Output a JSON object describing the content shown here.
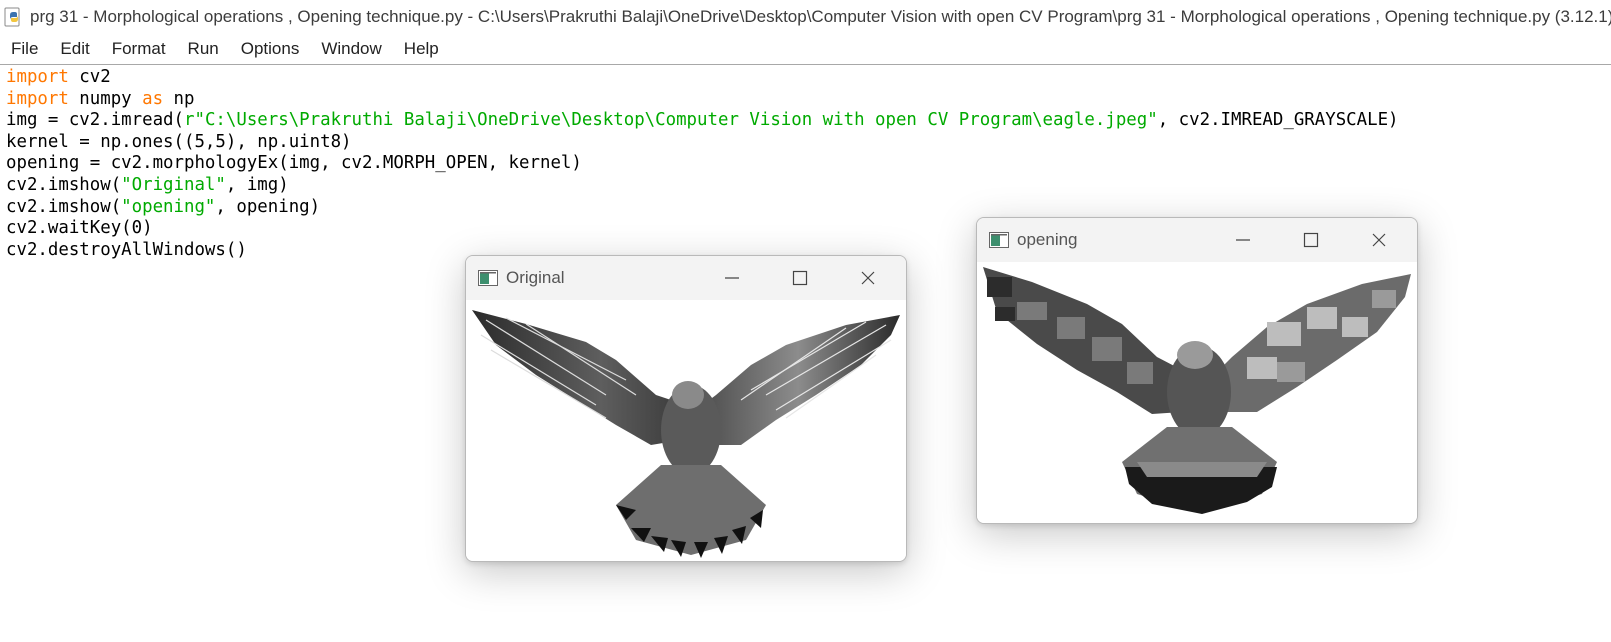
{
  "window": {
    "title": "prg 31 -  Morphological operations ,  Opening technique.py - C:\\Users\\Prakruthi Balaji\\OneDrive\\Desktop\\Computer Vision with open CV Program\\prg 31 -  Morphological operations ,  Opening technique.py (3.12.1)",
    "app_icon": "python-idle-icon"
  },
  "menu": [
    "File",
    "Edit",
    "Format",
    "Run",
    "Options",
    "Window",
    "Help"
  ],
  "code": {
    "l1": {
      "kw": "import",
      "rest": " cv2"
    },
    "l2": {
      "kw1": "import",
      "mid": " numpy ",
      "kw2": "as",
      "rest": " np"
    },
    "l3": {
      "pre": "img = cv2.imread(",
      "str": "r\"C:\\Users\\Prakruthi Balaji\\OneDrive\\Desktop\\Computer Vision with open CV Program\\eagle.jpeg\"",
      "post": ", cv2.IMREAD_GRAYSCALE)"
    },
    "l4": "kernel = np.ones((5,5), np.uint8)",
    "l5": "opening = cv2.morphologyEx(img, cv2.MORPH_OPEN, kernel)",
    "l6": {
      "pre": "cv2.imshow(",
      "str": "\"Original\"",
      "post": ", img)"
    },
    "l7": {
      "pre": "cv2.imshow(",
      "str": "\"opening\"",
      "post": ", opening)"
    },
    "l8": "cv2.waitKey(0)",
    "l9": "cv2.destroyAllWindows()"
  },
  "windows": {
    "original": {
      "title": "Original",
      "image": "eagle grayscale"
    },
    "opening": {
      "title": "opening",
      "image": "eagle after morphological opening"
    }
  },
  "colors": {
    "keyword": "#ff7700",
    "string": "#00aa00"
  }
}
